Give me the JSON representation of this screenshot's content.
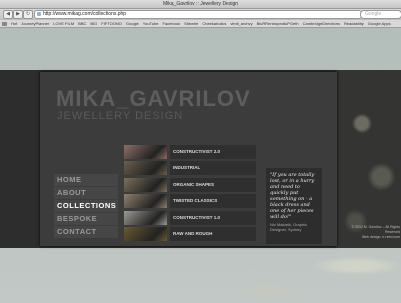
{
  "browser": {
    "window_title": "Mika_Gavrilov :: Jewellery Design",
    "url": "http://www.mikag.com/collections.php",
    "search_placeholder": "Google",
    "bookmarks": [
      "Hot",
      "JourneyPlanner",
      "LOVE FILM",
      "BBC",
      "BIG",
      "FIFTOONO",
      "Google",
      "YouTube",
      "Facebook",
      "Sitewire",
      "Cheekaholics",
      "vimit_archvy",
      "BluRRentropedtuPOeth",
      "CambridgeDirections",
      "Readability",
      "Google Apps"
    ]
  },
  "site": {
    "logo_line1": "MIKA_GAVRILOV",
    "logo_line2": "JEWELLERY DESIGN",
    "nav": [
      {
        "label": "HOME",
        "active": false
      },
      {
        "label": "ABOUT",
        "active": false
      },
      {
        "label": "COLLECTIONS",
        "active": true
      },
      {
        "label": "BESPOKE",
        "active": false
      },
      {
        "label": "CONTACT",
        "active": false
      }
    ],
    "collections": [
      {
        "label": "CONSTRUCTIVIST 2.0",
        "thumb": "#8c6f66"
      },
      {
        "label": "INDUSTRIAL",
        "thumb": "#6b5f4d"
      },
      {
        "label": "ORGANIC SHAPES",
        "thumb": "#7a715a"
      },
      {
        "label": "TWISTED CLASSICS",
        "thumb": "#8f8270"
      },
      {
        "label": "CONSTRUCTIVIST 1.0",
        "thumb": "#9c9a92"
      },
      {
        "label": "RAW AND ROUGH",
        "thumb": "#6a5a30"
      }
    ],
    "quote": {
      "text": "\"If you are totally lost, or in a hurry and need to quickly put something on - a black dress and one of her pieces will do!\"",
      "author": "Nic Makarik, Graphic Designer, Sydney"
    },
    "copyright_line1": "© 2012 M. Gavrilov – All Rights Reserved",
    "copyright_line2": "Web design: n-reed.com"
  }
}
